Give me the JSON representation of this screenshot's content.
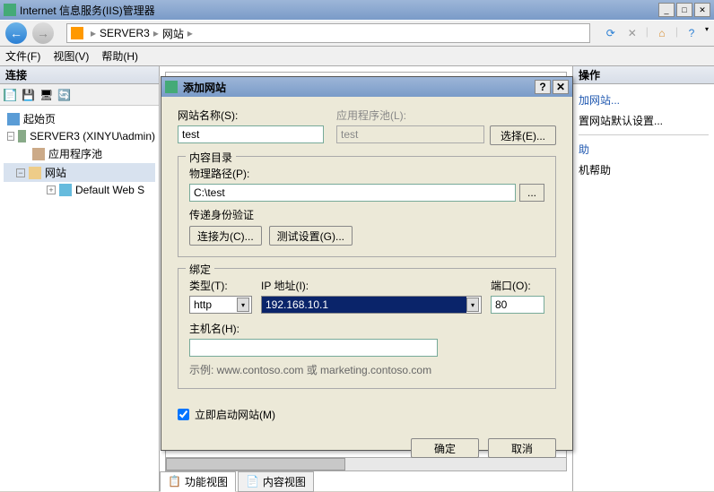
{
  "window": {
    "title": "Internet 信息服务(IIS)管理器"
  },
  "breadcrumb": {
    "node1": "SERVER3",
    "node2": "网站"
  },
  "menu": {
    "file": "文件(F)",
    "view": "视图(V)",
    "help": "帮助(H)"
  },
  "left": {
    "header": "连接",
    "tree": {
      "start": "起始页",
      "server": "SERVER3 (XINYU\\admin)",
      "apppool": "应用程序池",
      "sites": "网站",
      "default": "Default Web S"
    }
  },
  "right": {
    "header": "操作",
    "addsite": "加网站...",
    "defaults": "置网站默认设置...",
    "help": "助",
    "onlinehelp": "机帮助"
  },
  "bottom": {
    "tab1": "功能视图",
    "tab2": "内容视图"
  },
  "dialog": {
    "title": "添加网站",
    "sitename_label": "网站名称(S):",
    "sitename_value": "test",
    "apppool_label": "应用程序池(L):",
    "apppool_value": "test",
    "select_btn": "选择(E)...",
    "content_legend": "内容目录",
    "physpath_label": "物理路径(P):",
    "physpath_value": "C:\\test",
    "auth_label": "传递身份验证",
    "connectas_btn": "连接为(C)...",
    "testset_btn": "测试设置(G)...",
    "binding_legend": "绑定",
    "type_label": "类型(T):",
    "type_value": "http",
    "ip_label": "IP 地址(I):",
    "ip_value": "192.168.10.1",
    "port_label": "端口(O):",
    "port_value": "80",
    "hostname_label": "主机名(H):",
    "hostname_value": "",
    "example": "示例: www.contoso.com 或 marketing.contoso.com",
    "autostart": "立即启动网站(M)",
    "ok": "确定",
    "cancel": "取消"
  }
}
